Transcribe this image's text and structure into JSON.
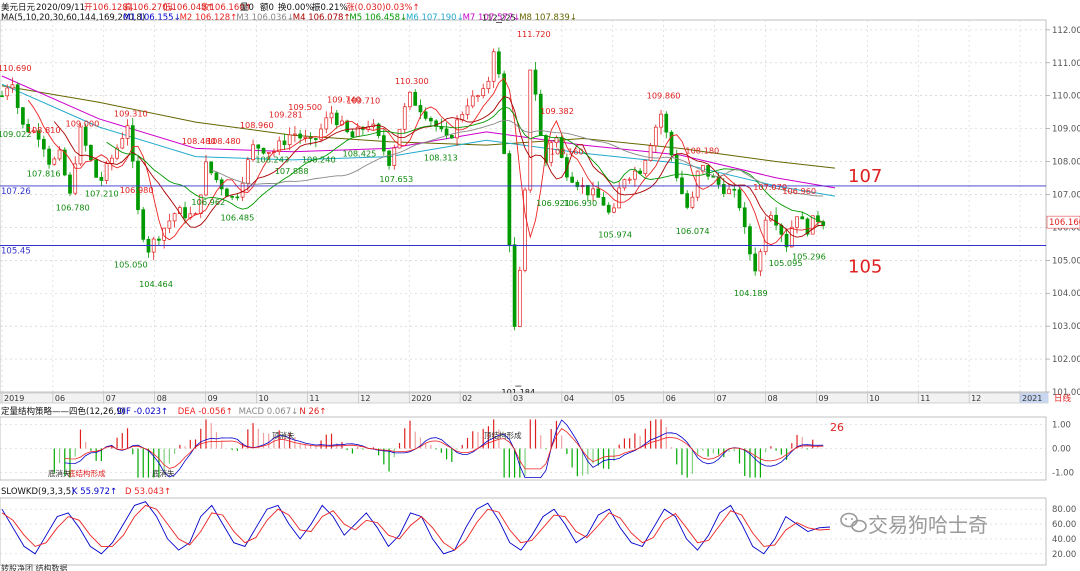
{
  "header": {
    "symbol": "美元日元",
    "date": "2020/09/11",
    "open": "开106.128↓",
    "high": "高106.270↓",
    "low": "低106.045↑",
    "close": "收106.160↑",
    "volume": "量0",
    "amount": "额0",
    "change_pct": "换0.00%",
    "amplitude": "振0.21%",
    "rise": "涨(0.030)0.03%↑"
  },
  "ma_line": {
    "label": "MA(5,10,20,30,60,144,169,200,8)",
    "items": [
      {
        "text": "M1 106.155↓",
        "color": "#0000cc"
      },
      {
        "text": "M2 106.128↑",
        "color": "#ee2222"
      },
      {
        "text": "M3 106.036↓",
        "color": "#888888"
      },
      {
        "text": "M4 106.078↑",
        "color": "#aa0000"
      },
      {
        "text": "M5 106.458↓",
        "color": "#009900"
      },
      {
        "text": "M6 107.190↓",
        "color": "#22aacc"
      },
      {
        "text": "M7 107.577↓",
        "color": "#cc00cc"
      },
      {
        "text": "M8 107.839↓",
        "color": "#666600"
      }
    ]
  },
  "colors": {
    "up": "#e02020",
    "down": "#009900",
    "hline": "#3333cc",
    "grid": "#c8c8c8",
    "annotation": "#e02020",
    "ma": [
      "#0000cc",
      "#ee2222",
      "#888888",
      "#aa0000",
      "#009900",
      "#22aacc",
      "#cc00cc",
      "#666600"
    ]
  },
  "chart_data": [
    {
      "type": "candlestick",
      "ylim": [
        101.0,
        112.3
      ],
      "y_ticks": [
        "112.000",
        "111.000",
        "110.000",
        "109.000",
        "108.000",
        "107.000",
        "106.000",
        "105.000",
        "104.000",
        "103.000",
        "102.000",
        "101.000"
      ],
      "x_ticks": [
        "2019",
        "06",
        "07",
        "08",
        "09",
        "10",
        "11",
        "12",
        "2020",
        "02",
        "03",
        "04",
        "05",
        "06",
        "07",
        "08",
        "09",
        "10",
        "11",
        "12",
        "2021"
      ],
      "x_axis_tag": "日线",
      "price_tag": "106.160",
      "hlines": [
        {
          "value": 107.26,
          "label": "107.26"
        },
        {
          "value": 105.45,
          "label": "105.45"
        }
      ],
      "annotations": [
        "107",
        "105"
      ],
      "peak_labels": [
        {
          "label": "110.690",
          "x": 0.5,
          "y": 110.69,
          "color": "red"
        },
        {
          "label": "109.022",
          "x": 0.5,
          "y": 109.02,
          "color": "green"
        },
        {
          "label": "108.810",
          "x": 2,
          "y": 108.81,
          "color": "red"
        },
        {
          "label": "107.816",
          "x": 2,
          "y": 107.82,
          "color": "green"
        },
        {
          "label": "109.000",
          "x": 4,
          "y": 109.0,
          "color": "red"
        },
        {
          "label": "106.780",
          "x": 3.5,
          "y": 106.78,
          "color": "green"
        },
        {
          "label": "107.210",
          "x": 5,
          "y": 107.21,
          "color": "green"
        },
        {
          "label": "109.310",
          "x": 6.5,
          "y": 109.31,
          "color": "red"
        },
        {
          "label": "106.980",
          "x": 6.8,
          "y": 106.98,
          "color": "red"
        },
        {
          "label": "105.050",
          "x": 6.5,
          "y": 105.05,
          "color": "green"
        },
        {
          "label": "104.464",
          "x": 7.8,
          "y": 104.46,
          "color": "green"
        },
        {
          "label": "106.962",
          "x": 10.5,
          "y": 106.96,
          "color": "green"
        },
        {
          "label": "106.485",
          "x": 12,
          "y": 106.49,
          "color": "green"
        },
        {
          "label": "108.480",
          "x": 10,
          "y": 108.48,
          "color": "red"
        },
        {
          "label": "108.480",
          "x": 11.3,
          "y": 108.48,
          "color": "red"
        },
        {
          "label": "108.960",
          "x": 13,
          "y": 108.96,
          "color": "red"
        },
        {
          "label": "109.281",
          "x": 14.5,
          "y": 109.28,
          "color": "red"
        },
        {
          "label": "109.500",
          "x": 15.5,
          "y": 109.5,
          "color": "red"
        },
        {
          "label": "108.243",
          "x": 13.8,
          "y": 108.24,
          "color": "green"
        },
        {
          "label": "107.888",
          "x": 14.8,
          "y": 107.89,
          "color": "green"
        },
        {
          "label": "108.240",
          "x": 16.2,
          "y": 108.24,
          "color": "green"
        },
        {
          "label": "109.740",
          "x": 17.5,
          "y": 109.74,
          "color": "red"
        },
        {
          "label": "109.710",
          "x": 18.5,
          "y": 109.71,
          "color": "red"
        },
        {
          "label": "108.425",
          "x": 18.3,
          "y": 108.43,
          "color": "green"
        },
        {
          "label": "110.300",
          "x": 21,
          "y": 110.3,
          "color": "red"
        },
        {
          "label": "107.653",
          "x": 20.2,
          "y": 107.65,
          "color": "green"
        },
        {
          "label": "108.313",
          "x": 22.5,
          "y": 108.31,
          "color": "green"
        },
        {
          "label": "112.225",
          "x": 25.5,
          "y": 112.23,
          "color": "black"
        },
        {
          "label": "111.720",
          "x": 27.3,
          "y": 111.72,
          "color": "red"
        },
        {
          "label": "109.382",
          "x": 28.5,
          "y": 109.38,
          "color": "red"
        },
        {
          "label": "108.160",
          "x": 29,
          "y": 108.16,
          "color": "red"
        },
        {
          "label": "101.184",
          "x": 26.5,
          "y": 101.18,
          "color": "black"
        },
        {
          "label": "106.921",
          "x": 28.3,
          "y": 106.92,
          "color": "green"
        },
        {
          "label": "106.930",
          "x": 29.7,
          "y": 106.93,
          "color": "green"
        },
        {
          "label": "105.974",
          "x": 31.5,
          "y": 105.97,
          "color": "green"
        },
        {
          "label": "109.860",
          "x": 34,
          "y": 109.86,
          "color": "red"
        },
        {
          "label": "108.180",
          "x": 36,
          "y": 108.18,
          "color": "red"
        },
        {
          "label": "106.074",
          "x": 35.5,
          "y": 106.07,
          "color": "green"
        },
        {
          "label": "107.070",
          "x": 39.5,
          "y": 107.07,
          "color": "red"
        },
        {
          "label": "106.960",
          "x": 41,
          "y": 106.96,
          "color": "red"
        },
        {
          "label": "104.189",
          "x": 38.5,
          "y": 104.19,
          "color": "green"
        },
        {
          "label": "105.095",
          "x": 40.3,
          "y": 105.1,
          "color": "green"
        },
        {
          "label": "105.296",
          "x": 41.5,
          "y": 105.3,
          "color": "green"
        }
      ],
      "approx_close_path": [
        {
          "x": 0,
          "y": 110.0
        },
        {
          "x": 0.5,
          "y": 110.6
        },
        {
          "x": 1,
          "y": 109.1
        },
        {
          "x": 2,
          "y": 108.8
        },
        {
          "x": 2.5,
          "y": 107.9
        },
        {
          "x": 3,
          "y": 108.2
        },
        {
          "x": 3.5,
          "y": 106.9
        },
        {
          "x": 4,
          "y": 109.0
        },
        {
          "x": 5,
          "y": 107.3
        },
        {
          "x": 6,
          "y": 108.5
        },
        {
          "x": 6.5,
          "y": 109.2
        },
        {
          "x": 7,
          "y": 106.5
        },
        {
          "x": 7.5,
          "y": 105.3
        },
        {
          "x": 8,
          "y": 105.7
        },
        {
          "x": 9,
          "y": 106.5
        },
        {
          "x": 10,
          "y": 106.3
        },
        {
          "x": 10.5,
          "y": 107.9
        },
        {
          "x": 11,
          "y": 107.5
        },
        {
          "x": 12,
          "y": 106.8
        },
        {
          "x": 13,
          "y": 108.5
        },
        {
          "x": 14,
          "y": 108.3
        },
        {
          "x": 15,
          "y": 108.9
        },
        {
          "x": 16,
          "y": 108.5
        },
        {
          "x": 17,
          "y": 109.5
        },
        {
          "x": 18,
          "y": 108.7
        },
        {
          "x": 19,
          "y": 109.2
        },
        {
          "x": 20,
          "y": 108.0
        },
        {
          "x": 21,
          "y": 110.0
        },
        {
          "x": 22,
          "y": 109.4
        },
        {
          "x": 23,
          "y": 108.6
        },
        {
          "x": 24,
          "y": 109.8
        },
        {
          "x": 25,
          "y": 110.1
        },
        {
          "x": 25.5,
          "y": 111.9
        },
        {
          "x": 26,
          "y": 107.5
        },
        {
          "x": 26.5,
          "y": 102.5
        },
        {
          "x": 27,
          "y": 107.0
        },
        {
          "x": 27.3,
          "y": 111.3
        },
        {
          "x": 28,
          "y": 107.8
        },
        {
          "x": 28.5,
          "y": 109.0
        },
        {
          "x": 29,
          "y": 107.8
        },
        {
          "x": 30,
          "y": 107.2
        },
        {
          "x": 31,
          "y": 106.8
        },
        {
          "x": 31.5,
          "y": 106.2
        },
        {
          "x": 32,
          "y": 107.5
        },
        {
          "x": 33,
          "y": 107.8
        },
        {
          "x": 34,
          "y": 109.5
        },
        {
          "x": 35,
          "y": 107.2
        },
        {
          "x": 35.5,
          "y": 106.4
        },
        {
          "x": 36,
          "y": 107.9
        },
        {
          "x": 37,
          "y": 107.3
        },
        {
          "x": 38,
          "y": 106.9
        },
        {
          "x": 38.5,
          "y": 105.4
        },
        {
          "x": 39,
          "y": 104.6
        },
        {
          "x": 39.5,
          "y": 106.7
        },
        {
          "x": 40,
          "y": 106.2
        },
        {
          "x": 40.5,
          "y": 105.5
        },
        {
          "x": 41,
          "y": 106.5
        },
        {
          "x": 41.5,
          "y": 105.9
        },
        {
          "x": 42,
          "y": 106.3
        },
        {
          "x": 42.5,
          "y": 106.16
        }
      ],
      "approx_ma_slow": [
        {
          "x": 0,
          "y": 110.3
        },
        {
          "x": 5,
          "y": 109.8
        },
        {
          "x": 10,
          "y": 109.2
        },
        {
          "x": 15,
          "y": 108.8
        },
        {
          "x": 20,
          "y": 108.6
        },
        {
          "x": 25,
          "y": 108.5
        },
        {
          "x": 30,
          "y": 108.7
        },
        {
          "x": 35,
          "y": 108.4
        },
        {
          "x": 40,
          "y": 108.0
        },
        {
          "x": 43,
          "y": 107.8
        }
      ],
      "approx_ma_mid": [
        {
          "x": 0,
          "y": 110.6
        },
        {
          "x": 5,
          "y": 109.3
        },
        {
          "x": 10,
          "y": 108.4
        },
        {
          "x": 15,
          "y": 108.3
        },
        {
          "x": 20,
          "y": 108.4
        },
        {
          "x": 25,
          "y": 108.9
        },
        {
          "x": 30,
          "y": 108.5
        },
        {
          "x": 35,
          "y": 108.2
        },
        {
          "x": 40,
          "y": 107.5
        },
        {
          "x": 43,
          "y": 107.2
        }
      ]
    },
    {
      "type": "bar",
      "title": "定量结构策略——四色(12,26,9)",
      "legend": [
        {
          "text": "DIF -0.023↑",
          "color": "#0000cc"
        },
        {
          "text": "DEA -0.056↑",
          "color": "#ee2222"
        },
        {
          "text": "MACD 0.067↓",
          "color": "#888888"
        },
        {
          "text": "N 26↑",
          "color": "#e02020"
        }
      ],
      "ylim": [
        -1.3,
        1.3
      ],
      "y_ticks": [
        "1.00",
        "0.00",
        "-1.00"
      ],
      "annotation": "26",
      "signal_labels": [
        "底结构形成",
        "底消失",
        "底消失",
        "顶消失",
        "顶结构形成"
      ]
    },
    {
      "type": "line",
      "title": "SLOWKD(9,3,3,5)",
      "legend": [
        {
          "text": "K 55.972↑",
          "color": "#0000cc"
        },
        {
          "text": "D 53.043↑",
          "color": "#ee2222"
        }
      ],
      "ylim": [
        5,
        95
      ],
      "y_ticks": [
        "80.00",
        "60.00",
        "40.00",
        "20.00"
      ],
      "series": [
        {
          "name": "K",
          "values": [
            80,
            55,
            30,
            20,
            45,
            70,
            75,
            55,
            30,
            20,
            35,
            60,
            85,
            90,
            70,
            40,
            25,
            35,
            70,
            85,
            60,
            35,
            30,
            55,
            80,
            85,
            60,
            40,
            60,
            85,
            70,
            45,
            60,
            75,
            55,
            30,
            45,
            75,
            70,
            40,
            20,
            25,
            55,
            80,
            88,
            65,
            35,
            25,
            45,
            70,
            80,
            60,
            35,
            45,
            72,
            80,
            55,
            35,
            30,
            55,
            80,
            70,
            40,
            25,
            45,
            75,
            85,
            60,
            30,
            20,
            40,
            70,
            60,
            50,
            55,
            56
          ]
        },
        {
          "name": "D",
          "values": [
            75,
            65,
            45,
            30,
            35,
            55,
            70,
            65,
            45,
            30,
            30,
            45,
            70,
            85,
            80,
            60,
            40,
            32,
            50,
            75,
            72,
            50,
            35,
            42,
            65,
            80,
            72,
            52,
            50,
            70,
            78,
            60,
            52,
            65,
            62,
            45,
            40,
            58,
            70,
            55,
            35,
            25,
            38,
            62,
            80,
            76,
            52,
            35,
            38,
            55,
            72,
            70,
            50,
            42,
            58,
            75,
            68,
            48,
            35,
            42,
            65,
            74,
            55,
            35,
            38,
            58,
            78,
            72,
            48,
            30,
            32,
            52,
            62,
            55,
            52,
            53
          ]
        }
      ]
    }
  ],
  "footer_partial": "转股净团 结构数据",
  "watermark": {
    "text": "交易狗哈士奇",
    "icon": "wechat-icon"
  }
}
